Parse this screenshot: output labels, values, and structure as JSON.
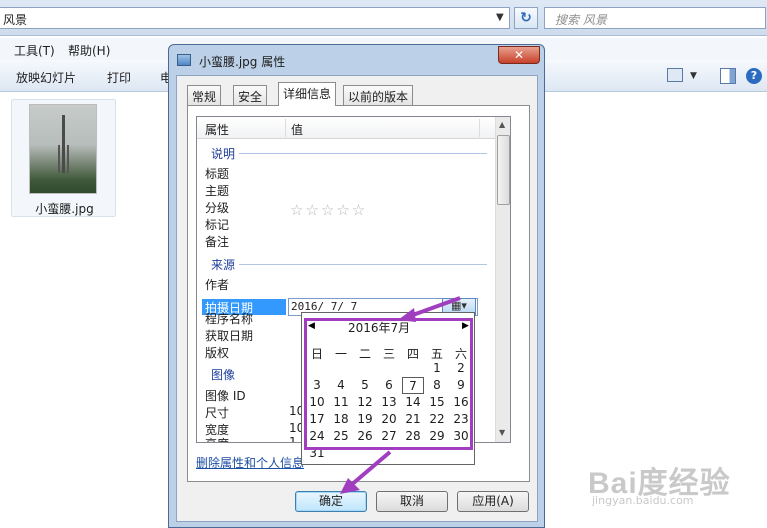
{
  "explorer": {
    "address_text": "风景",
    "search_placeholder": "搜索 风景",
    "menu": [
      "工具(T)",
      "帮助(H)"
    ],
    "toolbar": [
      "放映幻灯片",
      "打印",
      "电"
    ],
    "file": {
      "name": "小蛮腰.jpg"
    }
  },
  "dialog": {
    "title": "小蛮腰.jpg 属性",
    "close_label": "✕",
    "tabs": [
      "常规",
      "安全",
      "详细信息",
      "以前的版本"
    ],
    "active_tab": "详细信息",
    "columns": {
      "property": "属性",
      "value": "值"
    },
    "groups": {
      "description": "说明",
      "origin": "来源",
      "image": "图像"
    },
    "description_rows": [
      "标题",
      "主题",
      "分级",
      "标记",
      "备注"
    ],
    "rating_stars": "☆☆☆☆☆",
    "origin_rows": [
      "作者",
      "拍摄日期",
      "程序名称",
      "获取日期",
      "版权"
    ],
    "date_taken_value": "2016/ 7/ 7",
    "image_rows": [
      "图像 ID",
      "尺寸",
      "宽度",
      "高度"
    ],
    "image_values_partial": [
      "10",
      "10",
      "1"
    ],
    "remove_link": "删除属性和个人信息",
    "buttons": {
      "ok": "确定",
      "cancel": "取消",
      "apply": "应用(A)"
    }
  },
  "calendar": {
    "month_label": "2016年7月",
    "weekdays": [
      "日",
      "一",
      "二",
      "三",
      "四",
      "五",
      "六"
    ],
    "weeks": [
      [
        "",
        "",
        "",
        "",
        "",
        "1",
        "2"
      ],
      [
        "3",
        "4",
        "5",
        "6",
        "7",
        "8",
        "9"
      ],
      [
        "10",
        "11",
        "12",
        "13",
        "14",
        "15",
        "16"
      ],
      [
        "17",
        "18",
        "19",
        "20",
        "21",
        "22",
        "23"
      ],
      [
        "24",
        "25",
        "26",
        "27",
        "28",
        "29",
        "30"
      ],
      [
        "31",
        "",
        "",
        "",
        "",
        "",
        ""
      ]
    ],
    "selected_day": "7"
  },
  "watermark": {
    "logo": "Bai度经验",
    "url": "jingyan.baidu.com"
  },
  "colors": {
    "highlight": "#a13ec0",
    "selection": "#3399ff"
  }
}
